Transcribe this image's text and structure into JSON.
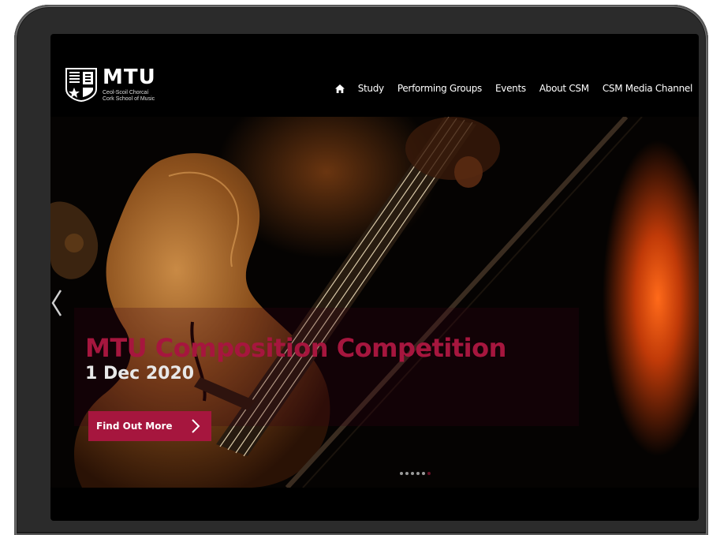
{
  "logo": {
    "name": "MTU",
    "line1": "Ceol-Scoil Chorcaí",
    "line2": "Cork School of Music"
  },
  "nav": {
    "items": [
      "Study",
      "Performing Groups",
      "Events",
      "About CSM",
      "CSM Media Channel"
    ]
  },
  "hero": {
    "title": "MTU Composition Competition",
    "date": "1 Dec 2020",
    "cta": "Find Out More",
    "slides_total": 6,
    "active_slide": 6
  },
  "colors": {
    "accent": "#a6163e",
    "background": "#000000"
  },
  "icons": [
    "home-icon",
    "chevron-right-icon",
    "chevron-left-icon"
  ]
}
